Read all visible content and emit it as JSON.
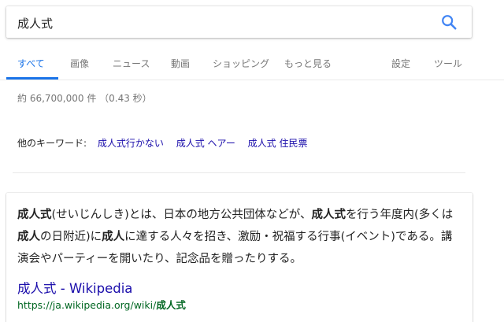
{
  "search": {
    "query": "成人式"
  },
  "colors": {
    "accent": "#1a73e8",
    "link": "#1a0dab",
    "url": "#006621"
  },
  "tabs": {
    "all": "すべて",
    "images": "画像",
    "news": "ニュース",
    "videos": "動画",
    "shopping": "ショッピング",
    "more": "もっと見る",
    "settings": "設定",
    "tools": "ツール"
  },
  "stats": "約 66,700,000 件 （0.43 秒）",
  "related": {
    "label": "他のキーワード:",
    "links": [
      "成人式行かない",
      "成人式 ヘアー",
      "成人式 住民票"
    ]
  },
  "snippet": {
    "b1": "成人式",
    "t1": "(せいじんしき)とは、日本の地方公共団体などが、",
    "b2": "成人式",
    "t2": "を行う年度内(多くは",
    "b3": "成人",
    "t3": "の日附近)に",
    "b4": "成人",
    "t4": "に達する人々を招き、激励・祝福する行事(イベント)である。講演会やパーティーを開いたり、記念品を贈ったりする。"
  },
  "wiki": {
    "title": "成人式 - Wikipedia",
    "url_prefix": "https://ja.wikipedia.org/wiki/",
    "url_bold": "成人式"
  }
}
